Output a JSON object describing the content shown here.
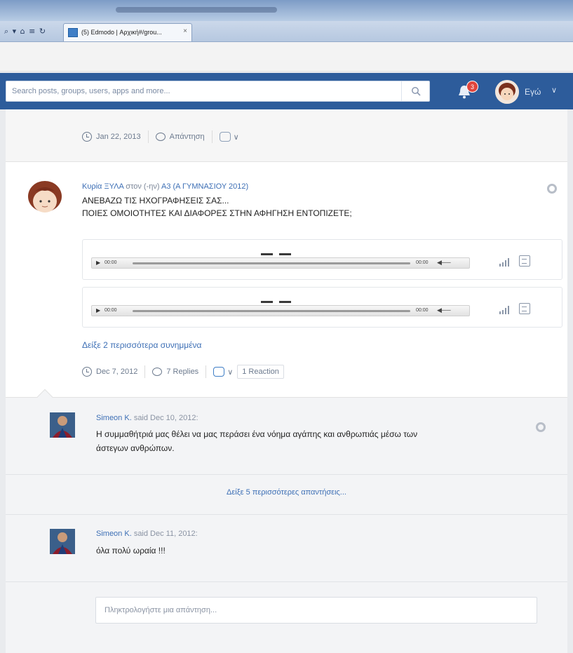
{
  "browser": {
    "nav_icons": "⌕ ▾ ⌂ ≡ ↻",
    "tab_title": "(5) Edmodo | Αρχική#/grou...",
    "tab_close": "×"
  },
  "header": {
    "search_placeholder": "Search posts, groups, users, apps and more...",
    "notification_count": "3",
    "user_label": "Εγώ",
    "chevron": "∨"
  },
  "previous_post": {
    "date": "Jan 22, 2013",
    "reply_label": "Απάντηση",
    "reaction_chevron": "∨"
  },
  "post": {
    "author": "Κυρία ΞΥΛΑ",
    "to_label": "στον (-ην)",
    "group": "Α3 (Α ΓΥΜΝΑΣΙΟΥ 2012)",
    "line1": "ΑΝΕΒΑΖΩ ΤΙΣ ΗΧΟΓΡΑΦΗΣΕΙΣ ΣΑΣ...",
    "line2": "ΠΟΙΕΣ ΟΜΟΙΟΤΗΤΕΣ ΚΑΙ ΔΙΑΦΟΡΕΣ ΣΤΗΝ ΑΦΗΓΗΣΗ ΕΝΤΟΠΙΖΕΤΕ;",
    "attachments": [
      {
        "time_start": "00:00",
        "time_end": "00:00",
        "play": "▶",
        "volume": "◀──"
      },
      {
        "time_start": "00:00",
        "time_end": "00:00",
        "play": "▶",
        "volume": "◀──"
      }
    ],
    "more_attachments": "Δείξε 2 περισσότερα συνημμένα",
    "date": "Dec 7, 2012",
    "replies": "7 Replies",
    "reaction_chevron": "∨",
    "reactions": "1 Reaction"
  },
  "replies": [
    {
      "author": "Simeon K.",
      "said": "said Dec 10, 2012:",
      "text_line1": "Η συμμαθήτριά μας θέλει να μας περάσει ένα νόημα αγάπης και ανθρωπιάς μέσω των",
      "text_line2": "άστεγων ανθρώπων."
    },
    {
      "author": "Simeon K.",
      "said": "said Dec 11, 2012:",
      "text_line1": "όλα πολύ ωραία !!!"
    }
  ],
  "more_replies": "Δείξε 5 περισσότερες απαντήσεις...",
  "reply_input_placeholder": "Πληκτρολογήστε μια απάντηση..."
}
